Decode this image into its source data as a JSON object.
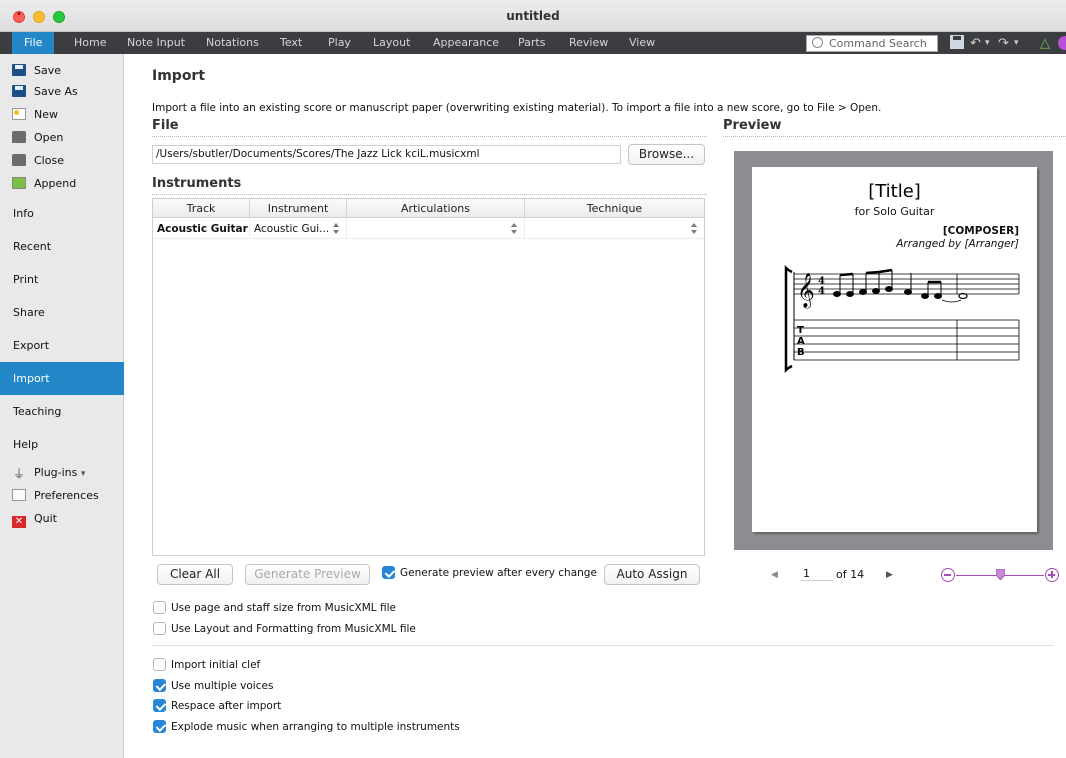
{
  "window": {
    "title": "untitled"
  },
  "ribbon": {
    "tabs": [
      "File",
      "Home",
      "Note Input",
      "Notations",
      "Text",
      "Play",
      "Layout",
      "Appearance",
      "Parts",
      "Review",
      "View"
    ],
    "active_tab": "File",
    "command_search_placeholder": "Command Search"
  },
  "sidebar": {
    "small_items": [
      "Save",
      "Save As",
      "New",
      "Open",
      "Close",
      "Append"
    ],
    "big_items": [
      "Info",
      "Recent",
      "Print",
      "Share",
      "Export",
      "Import",
      "Teaching",
      "Help"
    ],
    "active": "Import",
    "bottom_items": [
      "Plug-ins",
      "Preferences",
      "Quit"
    ],
    "plugins_suffix": "▾"
  },
  "main": {
    "title": "Import",
    "description": "Import a file into an existing score or manuscript paper (overwriting existing material). To import a file into a new score, go to File > Open.",
    "file_heading": "File",
    "file_path": "/Users/sbutler/Documents/Scores/The Jazz Lick kciL.musicxml",
    "browse_label": "Browse...",
    "instruments_heading": "Instruments",
    "table": {
      "columns": [
        "Track",
        "Instrument",
        "Articulations",
        "Technique"
      ],
      "rows": [
        {
          "track": "Acoustic Guitar",
          "instrument": "Acoustic Gui...",
          "articulations": "",
          "technique": ""
        }
      ]
    },
    "buttons": {
      "clear_all": "Clear All",
      "generate_preview": "Generate Preview",
      "auto_assign": "Auto Assign"
    },
    "generate_after_change": {
      "label": "Generate preview after every change",
      "checked": true
    },
    "options_layout": [
      {
        "label": "Use page and staff size from MusicXML file",
        "checked": false
      },
      {
        "label": "Use Layout and Formatting from MusicXML file",
        "checked": false
      }
    ],
    "options_import": [
      {
        "label": "Import initial clef",
        "checked": false
      },
      {
        "label": "Use multiple voices",
        "checked": true
      },
      {
        "label": "Respace after import",
        "checked": true
      },
      {
        "label": "Explode music when arranging to multiple instruments",
        "checked": true
      }
    ]
  },
  "preview": {
    "heading": "Preview",
    "score_title": "[Title]",
    "score_subtitle": "for Solo Guitar",
    "composer": "[COMPOSER]",
    "arranger": "Arranged by [Arranger]",
    "page_current": "1",
    "page_total_text": "of 14",
    "zoom_level": 0.5
  },
  "colors": {
    "accent": "#2386c6",
    "ribbon": "#3b3d41",
    "sidebar": "#e9e9e9"
  }
}
